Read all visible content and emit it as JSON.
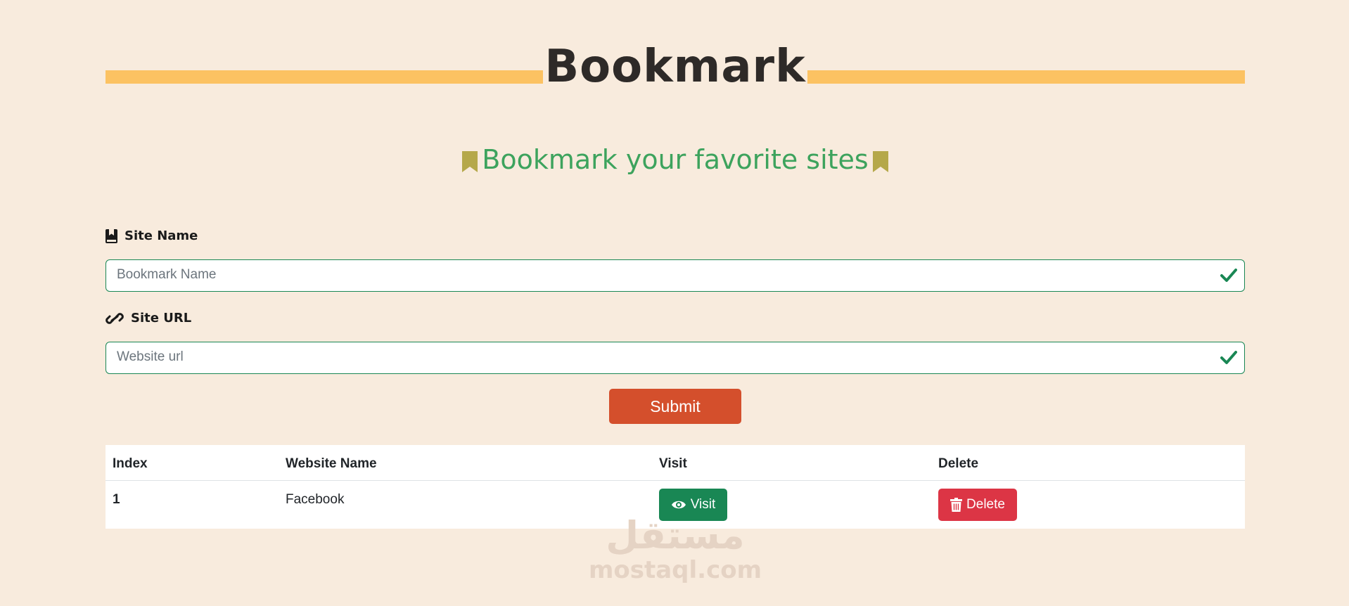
{
  "header": {
    "title": "Bookmark"
  },
  "subtitle": "Bookmark your favorite sites",
  "form": {
    "site_name_label": "Site Name",
    "site_name_placeholder": "Bookmark Name",
    "site_url_label": "Site URL",
    "site_url_placeholder": "Website url",
    "submit_label": "Submit"
  },
  "table": {
    "headers": [
      "Index",
      "Website Name",
      "Visit",
      "Delete"
    ],
    "rows": [
      {
        "index": "1",
        "name": "Facebook",
        "visit_label": "Visit",
        "delete_label": "Delete"
      }
    ]
  },
  "watermark": {
    "arabic": "مستقل",
    "latin": "mostaql.com"
  },
  "colors": {
    "background": "#f8ebdd",
    "title_bar": "#fcc262",
    "subtitle": "#3da35d",
    "bookmark_icon": "#b5a84a",
    "valid_border": "#198754",
    "submit": "#d44f2c",
    "visit": "#198754",
    "delete": "#dc3545"
  },
  "icons": {
    "subtitle": "bookmark-icon",
    "site_name": "book-bookmark-icon",
    "site_url": "link-icon",
    "valid": "check-icon",
    "visit": "eye-icon",
    "delete": "trash-icon"
  }
}
